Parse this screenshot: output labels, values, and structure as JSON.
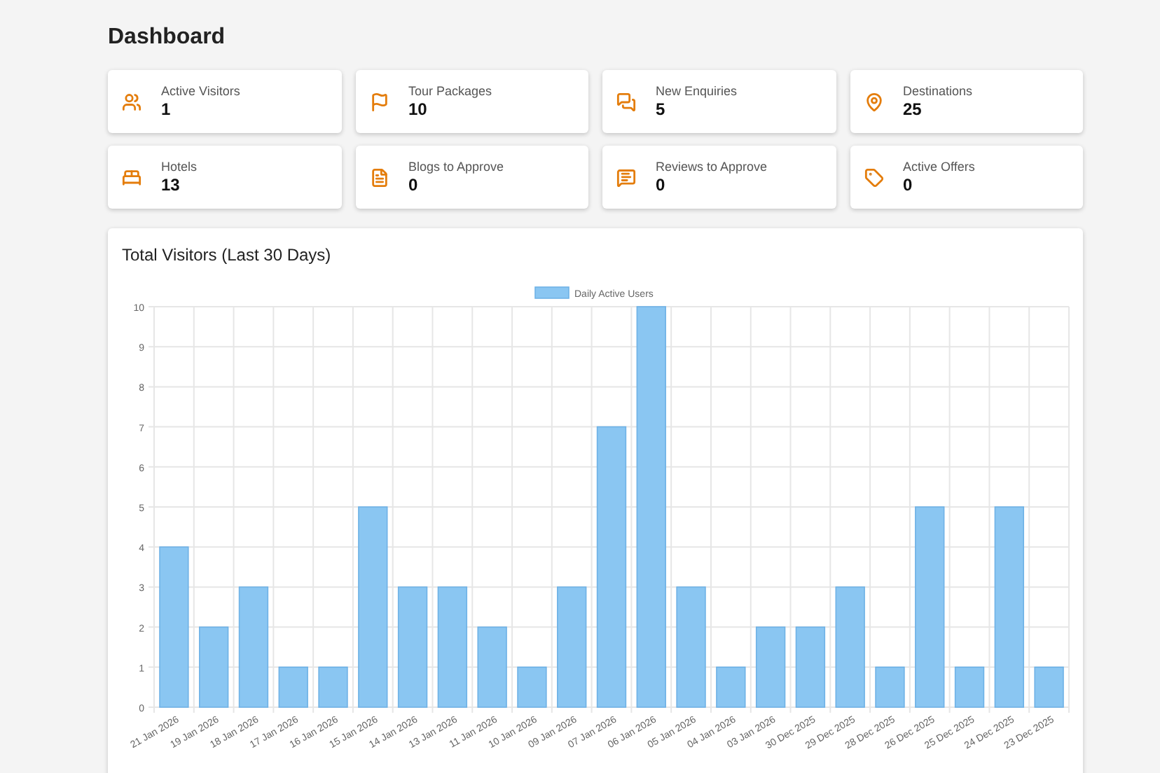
{
  "page_title": "Dashboard",
  "stats": [
    {
      "label": "Active Visitors",
      "value": "1"
    },
    {
      "label": "Tour Packages",
      "value": "10"
    },
    {
      "label": "New Enquiries",
      "value": "5"
    },
    {
      "label": "Destinations",
      "value": "25"
    },
    {
      "label": "Hotels",
      "value": "13"
    },
    {
      "label": "Blogs to Approve",
      "value": "0"
    },
    {
      "label": "Reviews to Approve",
      "value": "0"
    },
    {
      "label": "Active Offers",
      "value": "0"
    }
  ],
  "chart_panel": {
    "title": "Total Visitors (Last 30 Days)",
    "chart_data": {
      "type": "bar",
      "categories": [
        "21 Jan 2026",
        "19 Jan 2026",
        "18 Jan 2026",
        "17 Jan 2026",
        "16 Jan 2026",
        "15 Jan 2026",
        "14 Jan 2026",
        "13 Jan 2026",
        "11 Jan 2026",
        "10 Jan 2026",
        "09 Jan 2026",
        "07 Jan 2026",
        "06 Jan 2026",
        "05 Jan 2026",
        "04 Jan 2026",
        "03 Jan 2026",
        "30 Dec 2025",
        "29 Dec 2025",
        "28 Dec 2025",
        "26 Dec 2025",
        "25 Dec 2025",
        "24 Dec 2025",
        "23 Dec 2025"
      ],
      "series": [
        {
          "name": "Daily Active Users",
          "color": "#8ac6f2",
          "values": [
            4,
            2,
            3,
            1,
            1,
            5,
            3,
            3,
            2,
            1,
            3,
            7,
            10,
            3,
            1,
            2,
            2,
            3,
            1,
            5,
            1,
            5,
            1
          ]
        }
      ],
      "grid": true,
      "ylim": [
        0,
        10
      ],
      "yticks": [
        0,
        1,
        2,
        3,
        4,
        5,
        6,
        7,
        8,
        9,
        10
      ]
    }
  }
}
